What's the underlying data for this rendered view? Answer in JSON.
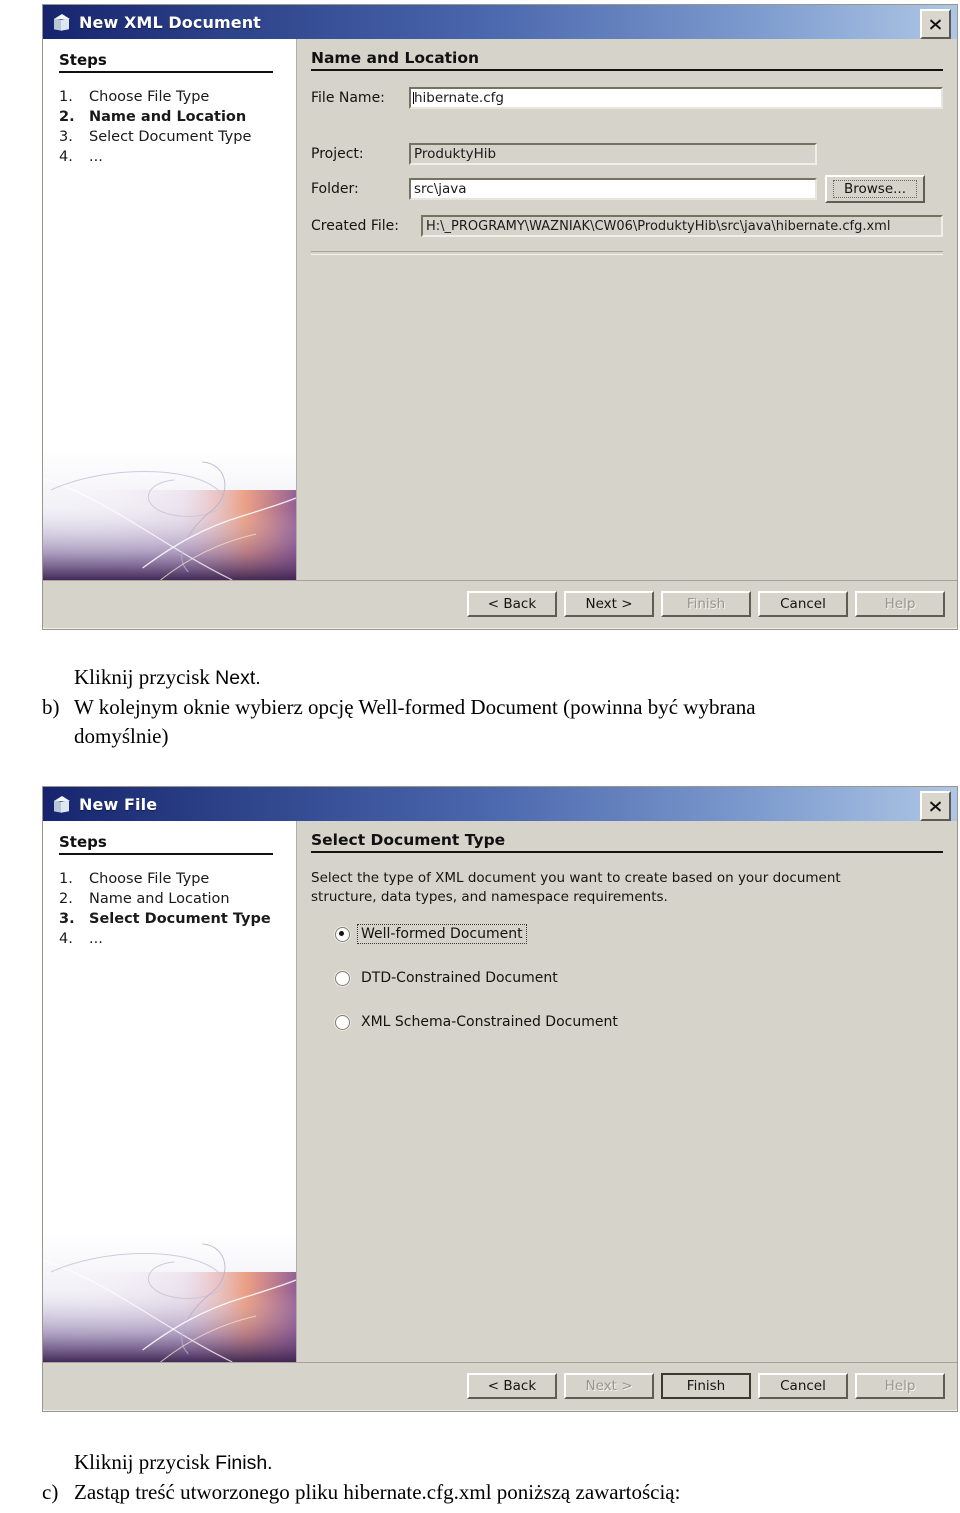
{
  "dialog1": {
    "title": "New XML Document",
    "title_icon": "cube-icon",
    "close_icon": "close-icon",
    "steps_title": "Steps",
    "steps": [
      {
        "num": "1.",
        "label": "Choose File Type",
        "current": false
      },
      {
        "num": "2.",
        "label": "Name and Location",
        "current": true
      },
      {
        "num": "3.",
        "label": "Select Document Type",
        "current": false
      },
      {
        "num": "4.",
        "label": "...",
        "current": false
      }
    ],
    "heading": "Name and Location",
    "fields": {
      "file_name_label": "File Name:",
      "file_name_value": "hibernate.cfg",
      "project_label": "Project:",
      "project_value": "ProduktyHib",
      "folder_label": "Folder:",
      "folder_value": "src\\java",
      "browse_label": "Browse...",
      "created_file_label": "Created File:",
      "created_file_value": "H:\\_PROGRAMY\\WAZNIAK\\CW06\\ProduktyHib\\src\\java\\hibernate.cfg.xml"
    },
    "buttons": [
      {
        "label": "< Back",
        "state": "enabled",
        "default": false
      },
      {
        "label": "Next >",
        "state": "enabled",
        "default": false
      },
      {
        "label": "Finish",
        "state": "disabled",
        "default": false
      },
      {
        "label": "Cancel",
        "state": "enabled",
        "default": false
      },
      {
        "label": "Help",
        "state": "disabled",
        "default": false
      }
    ]
  },
  "text1": {
    "line1_prefix": "Kliknij przycisk ",
    "line1_bold": "Next.",
    "marker": "b)",
    "line2": "W kolejnym oknie wybierz opcję Well-formed Document (powinna być wybrana",
    "line3": "domyślnie)"
  },
  "dialog2": {
    "title": "New File",
    "title_icon": "cube-icon",
    "close_icon": "close-icon",
    "steps_title": "Steps",
    "steps": [
      {
        "num": "1.",
        "label": "Choose File Type",
        "current": false
      },
      {
        "num": "2.",
        "label": "Name and Location",
        "current": false
      },
      {
        "num": "3.",
        "label": "Select Document Type",
        "current": true
      },
      {
        "num": "4.",
        "label": "...",
        "current": false
      }
    ],
    "heading": "Select Document Type",
    "description_line1": "Select the type of XML document you want to create based on your document",
    "description_line2": "structure, data types, and namespace requirements.",
    "options": [
      {
        "label": "Well-formed Document",
        "mnemonic": "W",
        "selected": true,
        "focused": true
      },
      {
        "label": "DTD-Constrained Document",
        "mnemonic": "D",
        "selected": false,
        "focused": false
      },
      {
        "label": "XML Schema-Constrained Document",
        "mnemonic": "S",
        "selected": false,
        "focused": false
      }
    ],
    "buttons": [
      {
        "label": "< Back",
        "state": "enabled",
        "default": false
      },
      {
        "label": "Next >",
        "state": "disabled",
        "default": false
      },
      {
        "label": "Finish",
        "state": "enabled",
        "default": true
      },
      {
        "label": "Cancel",
        "state": "enabled",
        "default": false
      },
      {
        "label": "Help",
        "state": "disabled",
        "default": false
      }
    ]
  },
  "text2": {
    "line1_prefix": "Kliknij przycisk ",
    "line1_bold": "Finish.",
    "marker": "c)",
    "line2": "Zastąp treść utworzonego pliku hibernate.cfg.xml poniższą zawartością:"
  },
  "colors": {
    "title_bar_start": "#16246e",
    "title_bar_end": "#aec6e6",
    "dialog_face": "#d6d3cb",
    "panel_white": "#ffffff"
  }
}
